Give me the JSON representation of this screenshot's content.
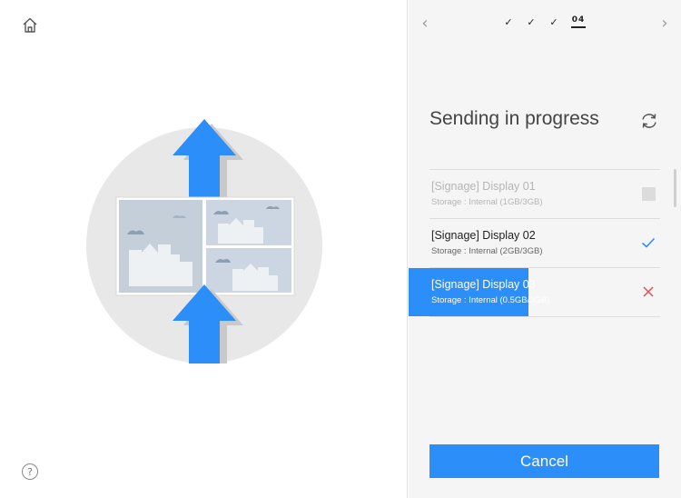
{
  "left": {
    "help_glyph": "?",
    "home_icon": "home-icon",
    "illustration": "upload-signage-illustration"
  },
  "stepper": {
    "prev_glyph": "‹",
    "next_glyph": "›",
    "steps": [
      "✓",
      "✓",
      "✓",
      "04"
    ],
    "current_step": 4
  },
  "title": "Sending in progress",
  "devices": [
    {
      "name": "[Signage] Display 01",
      "storage": "Storage : Internal (1GB/3GB)",
      "status": "pending"
    },
    {
      "name": "[Signage] Display 02",
      "storage": "Storage : Internal (2GB/3GB)",
      "status": "done"
    },
    {
      "name": "[Signage] Display 03",
      "storage": "Storage : Internal (0.5GB/3GB)",
      "status": "failed",
      "progress": 0.5
    }
  ],
  "cancel_label": "Cancel",
  "colors": {
    "accent": "#2c8ef8",
    "error": "#e05050",
    "panel_bg": "#f5f5f5",
    "circle_bg": "#e8e8e8"
  }
}
